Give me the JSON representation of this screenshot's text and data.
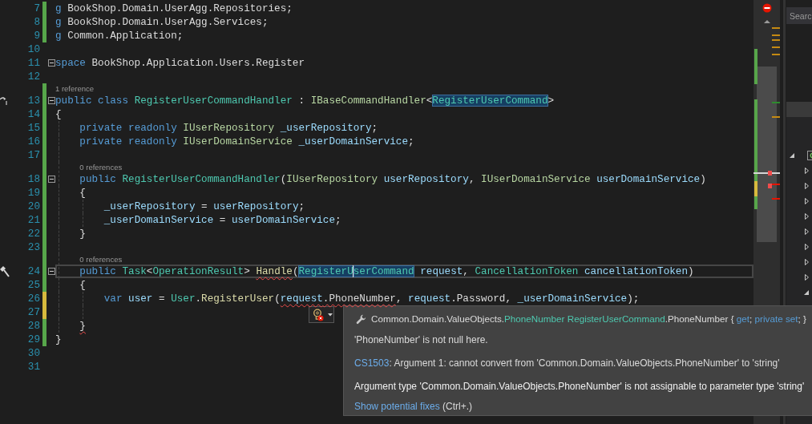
{
  "editor": {
    "lines": [
      {
        "number": "7",
        "changed": true,
        "unsaved": false,
        "fold": false,
        "current": false,
        "tokens": [
          {
            "text": "g",
            "kind": "keyword"
          },
          {
            "text": " BookShop.Domain.UserAgg.Repositories;",
            "kind": "plain"
          }
        ]
      },
      {
        "number": "8",
        "changed": true,
        "unsaved": false,
        "fold": false,
        "current": false,
        "tokens": [
          {
            "text": "g",
            "kind": "keyword"
          },
          {
            "text": " BookShop.Domain.UserAgg.Services;",
            "kind": "plain"
          }
        ]
      },
      {
        "number": "9",
        "changed": true,
        "unsaved": false,
        "fold": false,
        "current": false,
        "tokens": [
          {
            "text": "g",
            "kind": "keyword"
          },
          {
            "text": " Common.Application;",
            "kind": "plain"
          }
        ]
      },
      {
        "number": "10",
        "changed": false,
        "fold": false,
        "current": false
      },
      {
        "number": "11",
        "changed": false,
        "fold": true,
        "current": false,
        "tokens": [
          {
            "text": "space",
            "kind": "keyword"
          },
          {
            "text": " BookShop.Application.Users.Register",
            "kind": "plain"
          }
        ]
      },
      {
        "number": "12",
        "changed": false,
        "fold": false,
        "current": false
      },
      {
        "number": "13",
        "changed": true,
        "unsaved": false,
        "fold": true,
        "current": false,
        "margin_icon": {
          "kind": "arrow"
        },
        "codelens": "1 reference",
        "tokens": [
          {
            "text": "public class ",
            "kind": "keyword"
          },
          {
            "text": "RegisterUserCommandHandler",
            "kind": "type"
          },
          {
            "text": " : ",
            "kind": "plain"
          },
          {
            "text": "IBaseCommandHandler",
            "kind": "interface"
          },
          {
            "text": "<",
            "kind": "plain"
          },
          {
            "text": "RegisterUserCommand",
            "kind": "type",
            "highlight": true
          },
          {
            "text": ">",
            "kind": "plain"
          }
        ]
      },
      {
        "number": "14",
        "changed": true,
        "unsaved": false,
        "fold": false,
        "current": false,
        "tokens": [
          {
            "text": "{",
            "kind": "plain"
          }
        ]
      },
      {
        "number": "15",
        "changed": true,
        "unsaved": false,
        "fold": false,
        "current": false,
        "tokens": [
          {
            "text": "    private readonly ",
            "kind": "keyword"
          },
          {
            "text": "IUserRepository",
            "kind": "interface"
          },
          {
            "text": " _userRepository",
            "kind": "variable"
          },
          {
            "text": ";",
            "kind": "plain"
          }
        ]
      },
      {
        "number": "16",
        "changed": true,
        "unsaved": false,
        "fold": false,
        "current": false,
        "tokens": [
          {
            "text": "    private readonly ",
            "kind": "keyword"
          },
          {
            "text": "IUserDomainService",
            "kind": "interface"
          },
          {
            "text": " _userDomainService",
            "kind": "variable"
          },
          {
            "text": ";",
            "kind": "plain"
          }
        ]
      },
      {
        "number": "17",
        "changed": true,
        "unsaved": false,
        "fold": false,
        "current": false
      },
      {
        "number": "18",
        "changed": true,
        "unsaved": false,
        "fold": true,
        "current": false,
        "codelens": "0 references",
        "tokens": [
          {
            "text": "    public ",
            "kind": "keyword"
          },
          {
            "text": "RegisterUserCommandHandler",
            "kind": "type"
          },
          {
            "text": "(",
            "kind": "plain"
          },
          {
            "text": "IUserRepository",
            "kind": "interface"
          },
          {
            "text": " userRepository",
            "kind": "variable"
          },
          {
            "text": ", ",
            "kind": "plain"
          },
          {
            "text": "IUserDomainService",
            "kind": "interface"
          },
          {
            "text": " userDomainService",
            "kind": "variable"
          },
          {
            "text": ")",
            "kind": "plain"
          }
        ]
      },
      {
        "number": "19",
        "changed": true,
        "unsaved": false,
        "fold": false,
        "current": false,
        "tokens": [
          {
            "text": "    {",
            "kind": "plain"
          }
        ]
      },
      {
        "number": "20",
        "changed": true,
        "unsaved": false,
        "fold": false,
        "current": false,
        "tokens": [
          {
            "text": "        _userRepository",
            "kind": "variable"
          },
          {
            "text": " = ",
            "kind": "plain"
          },
          {
            "text": "userRepository",
            "kind": "variable"
          },
          {
            "text": ";",
            "kind": "plain"
          }
        ]
      },
      {
        "number": "21",
        "changed": true,
        "unsaved": false,
        "fold": false,
        "current": false,
        "tokens": [
          {
            "text": "        _userDomainService",
            "kind": "variable"
          },
          {
            "text": " = ",
            "kind": "plain"
          },
          {
            "text": "userDomainService",
            "kind": "variable"
          },
          {
            "text": ";",
            "kind": "plain"
          }
        ]
      },
      {
        "number": "22",
        "changed": true,
        "unsaved": false,
        "fold": false,
        "current": false,
        "tokens": [
          {
            "text": "    }",
            "kind": "plain"
          }
        ]
      },
      {
        "number": "23",
        "changed": true,
        "unsaved": false,
        "fold": false,
        "current": false
      },
      {
        "number": "24",
        "changed": true,
        "unsaved": false,
        "fold": true,
        "current": true,
        "margin_icon": {
          "kind": "hammer"
        },
        "codelens": "0 references",
        "tokens": [
          {
            "text": "    public ",
            "kind": "keyword"
          },
          {
            "text": "Task",
            "kind": "type"
          },
          {
            "text": "<",
            "kind": "plain"
          },
          {
            "text": "OperationResult",
            "kind": "type"
          },
          {
            "text": "> ",
            "kind": "plain"
          },
          {
            "text": "Handle",
            "kind": "method",
            "squiggle": true
          },
          {
            "text": "(",
            "kind": "plain"
          },
          {
            "text": "RegisterU",
            "kind": "type",
            "highlight": true,
            "caret": true
          },
          {
            "text": "serCommand",
            "kind": "type",
            "highlight": true
          },
          {
            "text": " request",
            "kind": "variable"
          },
          {
            "text": ", ",
            "kind": "plain"
          },
          {
            "text": "CancellationToken",
            "kind": "type"
          },
          {
            "text": " cancellationToken",
            "kind": "variable"
          },
          {
            "text": ")",
            "kind": "plain"
          }
        ]
      },
      {
        "number": "25",
        "changed": true,
        "unsaved": false,
        "fold": false,
        "current": false,
        "tokens": [
          {
            "text": "    {",
            "kind": "plain"
          }
        ]
      },
      {
        "number": "26",
        "changed": true,
        "unsaved": true,
        "fold": false,
        "current": false,
        "tokens": [
          {
            "text": "        var ",
            "kind": "keyword"
          },
          {
            "text": "user",
            "kind": "variable"
          },
          {
            "text": " = ",
            "kind": "plain"
          },
          {
            "text": "User",
            "kind": "type"
          },
          {
            "text": ".",
            "kind": "plain"
          },
          {
            "text": "RegisterUser",
            "kind": "method"
          },
          {
            "text": "(",
            "kind": "plain"
          },
          {
            "text": "request",
            "kind": "variable",
            "squiggle": true
          },
          {
            "text": ".PhoneNumber",
            "kind": "plain",
            "squiggle": true
          },
          {
            "text": ", ",
            "kind": "plain"
          },
          {
            "text": "request",
            "kind": "variable"
          },
          {
            "text": ".Password, ",
            "kind": "plain"
          },
          {
            "text": "_userDomainService",
            "kind": "variable"
          },
          {
            "text": ");",
            "kind": "plain"
          }
        ]
      },
      {
        "number": "27",
        "changed": true,
        "unsaved": true,
        "fold": false,
        "current": false
      },
      {
        "number": "28",
        "changed": true,
        "unsaved": false,
        "fold": false,
        "current": false,
        "tokens": [
          {
            "text": "    }",
            "kind": "plain",
            "squiggle": true
          }
        ]
      },
      {
        "number": "29",
        "changed": true,
        "unsaved": false,
        "fold": false,
        "current": false,
        "tokens": [
          {
            "text": "}",
            "kind": "plain"
          }
        ]
      },
      {
        "number": "30",
        "changed": false,
        "fold": false,
        "current": false
      },
      {
        "number": "31",
        "changed": false,
        "fold": false,
        "current": false
      }
    ]
  },
  "quick_info": {
    "signature": [
      {
        "text": "Common.Domain.ValueObjects.",
        "kind": "plain"
      },
      {
        "text": "PhoneNumber RegisterUserCommand",
        "kind": "type"
      },
      {
        "text": ".PhoneNumber { ",
        "kind": "plain"
      },
      {
        "text": "get",
        "kind": "keyword"
      },
      {
        "text": "; ",
        "kind": "plain"
      },
      {
        "text": "private set",
        "kind": "keyword"
      },
      {
        "text": "; }",
        "kind": "plain"
      }
    ],
    "note": "'PhoneNumber' is not null here.",
    "error": {
      "code": "CS1503",
      "message": ": Argument 1: cannot convert from 'Common.Domain.ValueObjects.PhoneNumber' to 'string'"
    },
    "detail": "Argument type 'Common.Domain.ValueObjects.PhoneNumber' is not assignable to parameter type 'string'",
    "fix": {
      "link": "Show potential fixes",
      "shortcut": "(Ctrl+.)"
    }
  },
  "solution_explorer": {
    "search": {
      "placeholder": "Searc"
    },
    "tree": [
      {
        "expanded": true,
        "children": [
          {
            "expanded": false
          },
          {
            "expanded": false
          },
          {
            "expanded": false
          },
          {
            "expanded": false
          },
          {
            "expanded": false
          },
          {
            "expanded": false
          },
          {
            "expanded": false
          },
          {
            "expanded": false
          },
          {
            "expanded": true
          }
        ]
      }
    ]
  }
}
